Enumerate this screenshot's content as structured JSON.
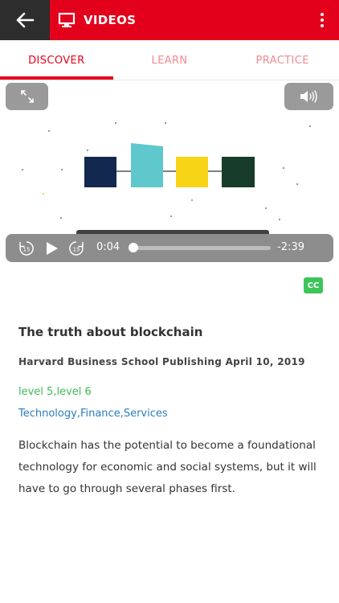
{
  "header": {
    "title": "VIDEOS",
    "back_icon": "arrow-left-icon",
    "title_icon": "monitor-icon",
    "menu_icon": "more-vertical-icon",
    "brand_color": "#e3001b"
  },
  "tabs": [
    {
      "label": "DISCOVER",
      "active": true
    },
    {
      "label": "LEARN",
      "active": false
    },
    {
      "label": "PRACTICE",
      "active": false
    }
  ],
  "player": {
    "fullscreen_icon": "expand-icon",
    "volume_icon": "volume-icon",
    "rewind_icon": "rewind-15-icon",
    "play_icon": "play-icon",
    "forward_icon": "forward-15-icon",
    "skip_seconds": "15",
    "current_time": "0:04",
    "remaining_time": "-2:39",
    "progress_percent": 2.5,
    "cc_label": "CC",
    "block_colors": [
      "#13284f",
      "#5ec8cc",
      "#f7d415",
      "#173c2a"
    ]
  },
  "video": {
    "title": "The truth about blockchain",
    "publisher_date": "Harvard Business School Publishing April 10, 2019",
    "levels": "level 5,level 6",
    "topics": "Technology,Finance,Services",
    "description": "Blockchain has the potential to become a foundational technology for economic and social systems, but it will have to go through several phases first."
  }
}
